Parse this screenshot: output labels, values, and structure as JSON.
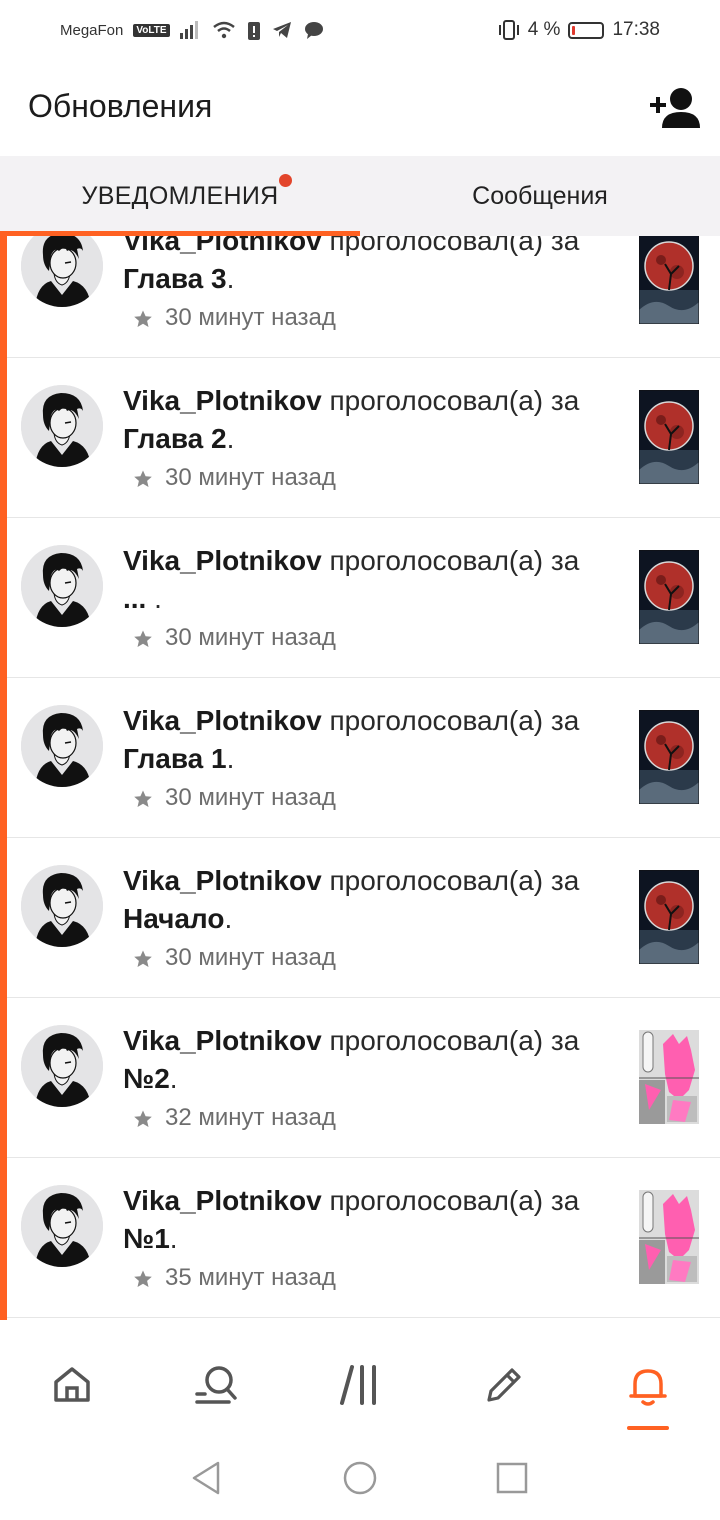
{
  "status_bar": {
    "carrier": "MegaFon",
    "volte": "VoLTE",
    "battery": "4 %",
    "time": "17:38",
    "battery_level": 0.04
  },
  "header": {
    "title": "Обновления"
  },
  "tabs": {
    "notifications": "УВЕДОМЛЕНИЯ",
    "messages": "Сообщения"
  },
  "notifications": [
    {
      "user": "Vika_Plotnikov",
      "action": " проголосовал(а) за ",
      "target": "Глава 3",
      "tail": ".",
      "time": "30 минут назад",
      "cover": "dark-moon"
    },
    {
      "user": "Vika_Plotnikov",
      "action": " проголосовал(а) за ",
      "target": "Глава 2",
      "tail": ".",
      "time": "30 минут назад",
      "cover": "dark-moon"
    },
    {
      "user": "Vika_Plotnikov",
      "action": " проголосовал(а) за ",
      "target": "...",
      "tail": " .",
      "time": "30 минут назад",
      "cover": "dark-moon"
    },
    {
      "user": "Vika_Plotnikov",
      "action": " проголосовал(а) за ",
      "target": "Глава 1",
      "tail": ".",
      "time": "30 минут назад",
      "cover": "dark-moon"
    },
    {
      "user": "Vika_Plotnikov",
      "action": " проголосовал(а) за ",
      "target": "Начало",
      "tail": ".",
      "time": "30 минут назад",
      "cover": "dark-moon"
    },
    {
      "user": "Vika_Plotnikov",
      "action": " проголосовал(а) за ",
      "target": "№2",
      "tail": ".",
      "time": "32 минут назад",
      "cover": "pink-manga"
    },
    {
      "user": "Vika_Plotnikov",
      "action": " проголосовал(а) за ",
      "target": "№1",
      "tail": ".",
      "time": "35 минут назад",
      "cover": "pink-manga"
    }
  ],
  "bottom_nav": {
    "items": [
      "home-icon",
      "search-icon",
      "library-icon",
      "write-icon",
      "bell-icon"
    ],
    "active": "bell-icon"
  },
  "colors": {
    "accent": "#ff6122",
    "badge": "#e2452b",
    "tab_bg": "#f3f2f4"
  }
}
